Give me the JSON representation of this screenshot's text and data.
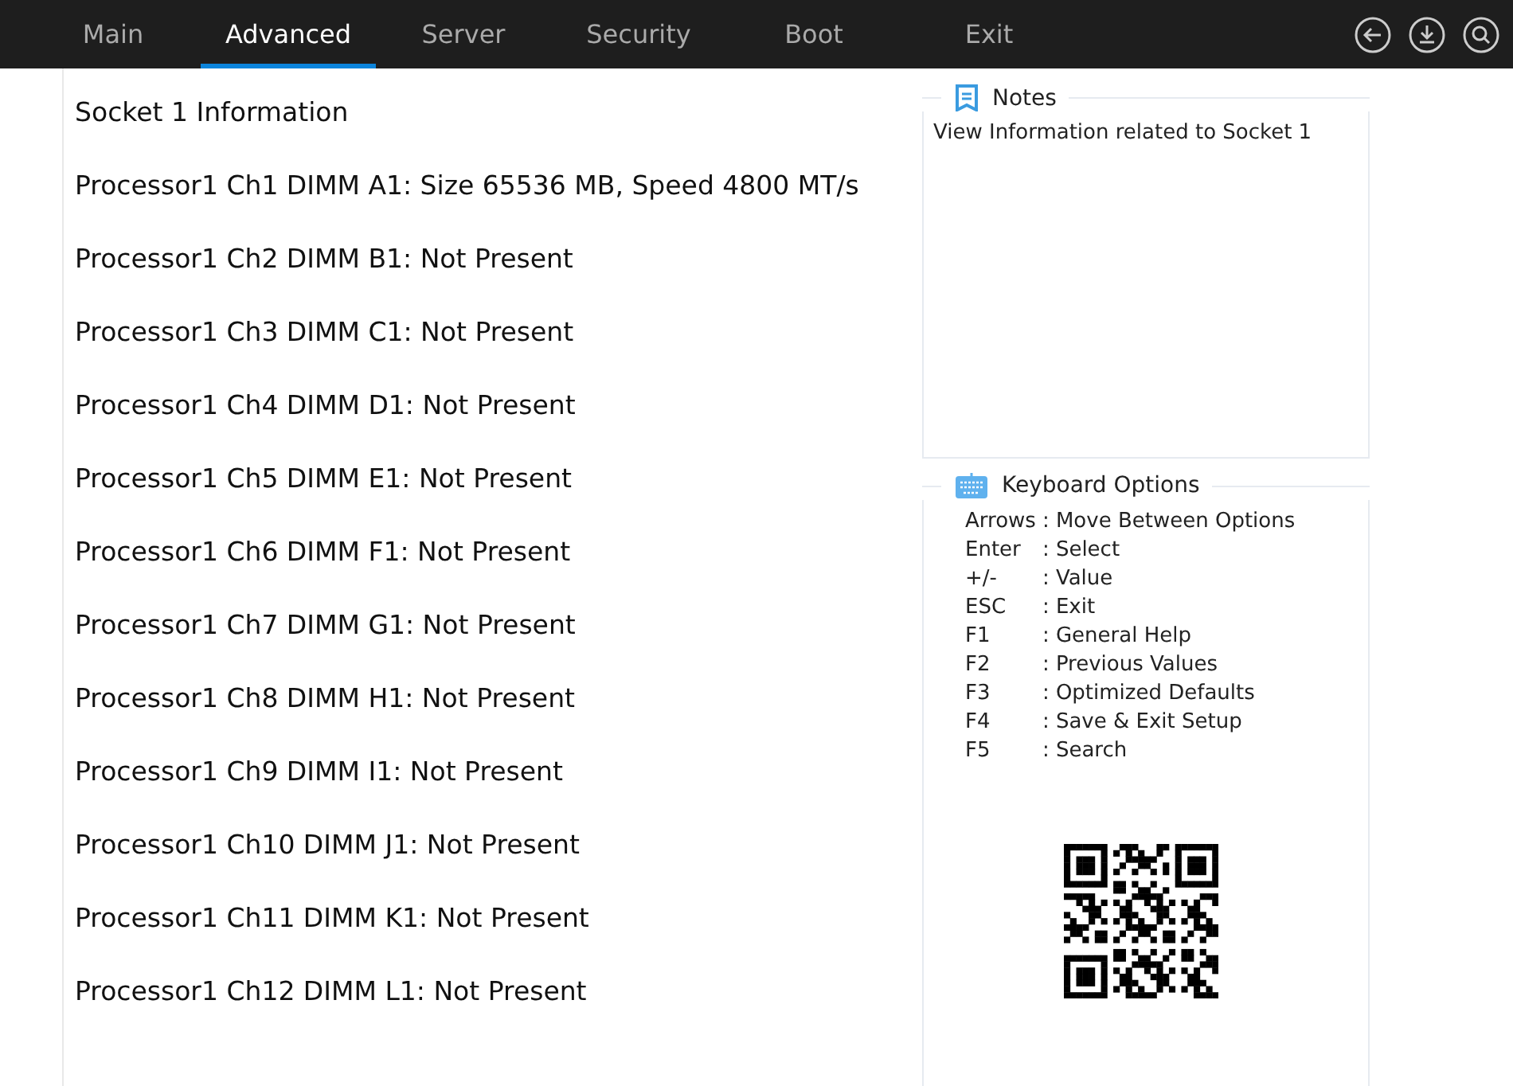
{
  "tabs": [
    {
      "label": "Main",
      "selected": false
    },
    {
      "label": "Advanced",
      "selected": true
    },
    {
      "label": "Server",
      "selected": false
    },
    {
      "label": "Security",
      "selected": false
    },
    {
      "label": "Boot",
      "selected": false
    },
    {
      "label": "Exit",
      "selected": false
    }
  ],
  "lines": [
    "Socket 1 Information",
    "Processor1 Ch1 DIMM A1: Size 65536 MB, Speed 4800 MT/s",
    "Processor1 Ch2 DIMM B1: Not Present",
    "Processor1 Ch3 DIMM C1: Not Present",
    "Processor1 Ch4 DIMM D1: Not Present",
    "Processor1 Ch5 DIMM E1: Not Present",
    "Processor1 Ch6 DIMM F1: Not Present",
    "Processor1 Ch7 DIMM G1: Not Present",
    "Processor1 Ch8 DIMM H1: Not Present",
    "Processor1 Ch9 DIMM I1: Not Present",
    "Processor1 Ch10 DIMM J1: Not Present",
    "Processor1 Ch11 DIMM K1: Not Present",
    "Processor1 Ch12 DIMM L1: Not Present"
  ],
  "notes": {
    "title": "Notes",
    "text": "View Information related to Socket 1"
  },
  "keyboard": {
    "title": "Keyboard Options",
    "keys": [
      {
        "key": "Arrows",
        "action": ": Move Between Options"
      },
      {
        "key": "Enter",
        "action": ": Select"
      },
      {
        "key": "+/-",
        "action": ": Value"
      },
      {
        "key": "ESC",
        "action": ": Exit"
      },
      {
        "key": "F1",
        "action": ": General Help"
      },
      {
        "key": "F2",
        "action": ": Previous Values"
      },
      {
        "key": "F3",
        "action": ": Optimized Defaults"
      },
      {
        "key": "F4",
        "action": ": Save & Exit Setup"
      },
      {
        "key": "F5",
        "action": ": Search"
      }
    ]
  }
}
